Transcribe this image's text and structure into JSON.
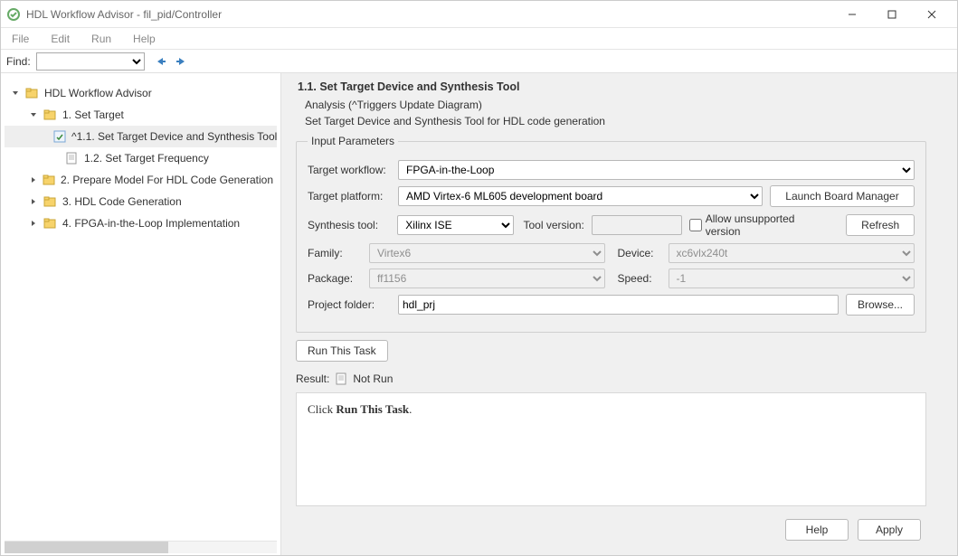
{
  "window": {
    "title": "HDL Workflow Advisor - fil_pid/Controller"
  },
  "menu": {
    "file": "File",
    "edit": "Edit",
    "run": "Run",
    "help": "Help"
  },
  "find": {
    "label": "Find:",
    "value": ""
  },
  "tree": {
    "root": "HDL Workflow Advisor",
    "n1": "1. Set Target",
    "n1_1": "^1.1. Set Target Device and Synthesis Tool",
    "n1_2": "1.2. Set Target Frequency",
    "n2": "2. Prepare Model For HDL Code Generation",
    "n3": "3. HDL Code Generation",
    "n4": "4. FPGA-in-the-Loop Implementation"
  },
  "panel": {
    "title": "1.1. Set Target Device and Synthesis Tool",
    "analysis": "Analysis (^Triggers Update Diagram)",
    "desc": "Set Target Device and Synthesis Tool for HDL code generation",
    "group": "Input Parameters",
    "labels": {
      "workflow": "Target workflow:",
      "platform": "Target platform:",
      "synth": "Synthesis tool:",
      "toolver": "Tool version:",
      "allow": "Allow unsupported version",
      "family": "Family:",
      "device": "Device:",
      "pkg": "Package:",
      "speed": "Speed:",
      "projfolder": "Project folder:"
    },
    "values": {
      "workflow": "FPGA-in-the-Loop",
      "platform": "AMD Virtex-6 ML605 development board",
      "synth": "Xilinx ISE",
      "toolver": "",
      "family": "Virtex6",
      "device": "xc6vlx240t",
      "pkg": "ff1156",
      "speed": "-1",
      "projfolder": "hdl_prj"
    },
    "buttons": {
      "boardmgr": "Launch Board Manager",
      "refresh": "Refresh",
      "browse": "Browse...",
      "runtask": "Run This Task"
    },
    "result": {
      "label": "Result:",
      "status": "Not Run",
      "msg_prefix": "Click ",
      "msg_bold": "Run This Task",
      "msg_suffix": "."
    }
  },
  "footer": {
    "help": "Help",
    "apply": "Apply"
  }
}
